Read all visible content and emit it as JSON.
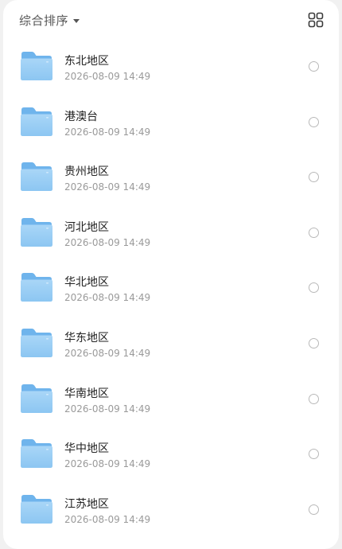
{
  "toolbar": {
    "sort_label": "综合排序",
    "sort_icon": "caret-down-icon",
    "view_icon": "grid-view-icon"
  },
  "colors": {
    "folder_light": "#a9d6f7",
    "folder_dark": "#6fb4ec",
    "radio_border": "#b9b9b9"
  },
  "folders": [
    {
      "name": "东北地区",
      "date": "2026-08-09 14:49"
    },
    {
      "name": "港澳台",
      "date": "2026-08-09 14:49"
    },
    {
      "name": "贵州地区",
      "date": "2026-08-09 14:49"
    },
    {
      "name": "河北地区",
      "date": "2026-08-09 14:49"
    },
    {
      "name": "华北地区",
      "date": "2026-08-09 14:49"
    },
    {
      "name": "华东地区",
      "date": "2026-08-09 14:49"
    },
    {
      "name": "华南地区",
      "date": "2026-08-09 14:49"
    },
    {
      "name": "华中地区",
      "date": "2026-08-09 14:49"
    },
    {
      "name": "江苏地区",
      "date": "2026-08-09 14:49"
    }
  ]
}
